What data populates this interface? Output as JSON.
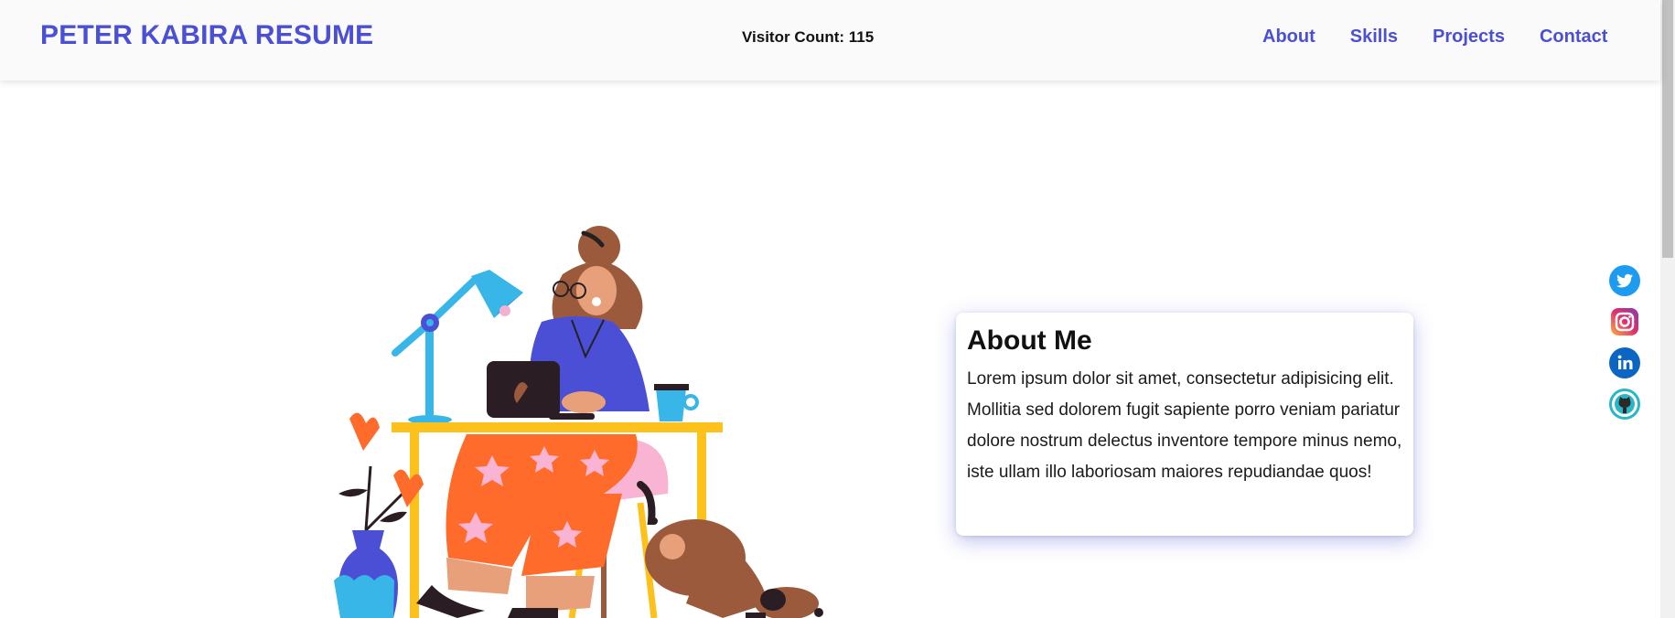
{
  "header": {
    "brand": "PETER KABIRA RESUME",
    "visitor_count": "Visitor Count: 115",
    "nav": [
      {
        "label": "About"
      },
      {
        "label": "Skills"
      },
      {
        "label": "Projects"
      },
      {
        "label": "Contact"
      }
    ]
  },
  "about": {
    "title": "About Me",
    "text": "Lorem ipsum dolor sit amet, consectetur adipisicing elit. Mollitia sed dolorem fugit sapiente porro veniam pariatur dolore nostrum delectus inventore tempore minus nemo, iste ullam illo laboriosam maiores repudiandae quos!"
  },
  "social": [
    {
      "icon": "twitter-icon"
    },
    {
      "icon": "instagram-icon"
    },
    {
      "icon": "linkedin-icon"
    },
    {
      "icon": "github-icon"
    }
  ],
  "colors": {
    "accent": "#4a4fd6",
    "navbar_bg": "#fafafa",
    "twitter": "#1d9bf0",
    "linkedin": "#0a66c2",
    "github_ring": "#2bb5c9"
  }
}
